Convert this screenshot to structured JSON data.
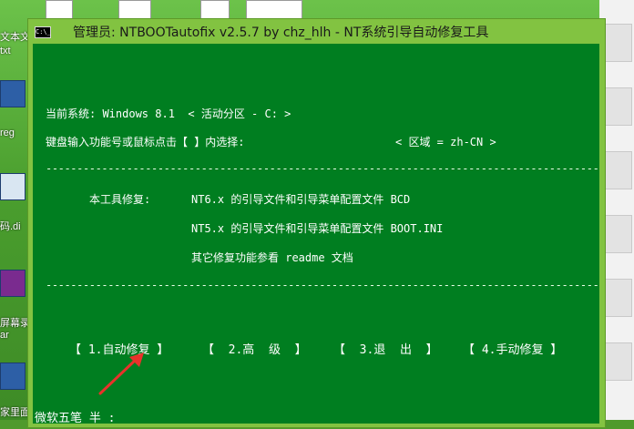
{
  "window": {
    "title": "管理员:  NTBOOTautofix v2.5.7 by chz_hlh - NT系统引导自动修复工具",
    "icon_text": "C:\\_"
  },
  "console": {
    "current_system": "当前系统: Windows 8.1  < 活动分区 - C: >",
    "prompt": "键盘输入功能号或鼠标点击【 】内选择:",
    "region": "< 区域 = zh-CN >",
    "separator": "------------------------------------------------------------------------------------------",
    "repair_label": "本工具修复:",
    "repair_items": [
      "NT6.x 的引导文件和引导菜单配置文件 BCD",
      "NT5.x 的引导文件和引导菜单配置文件 BOOT.INI",
      "其它修复功能参看 readme 文档"
    ],
    "menu": [
      "【 1.自动修复 】",
      "【  2.高  级  】",
      "【  3.退  出  】",
      "【 4.手动修复 】"
    ],
    "ime_status": "微软五笔 半 :"
  },
  "desktop": {
    "labels": [
      "文本文",
      "txt",
      "reg",
      "码.di",
      "屏幕录",
      "ar",
      "家里面"
    ]
  },
  "colors": {
    "console_bg": "#007e20",
    "window_frame": "#82c341",
    "annotation_arrow": "#e8322b"
  }
}
